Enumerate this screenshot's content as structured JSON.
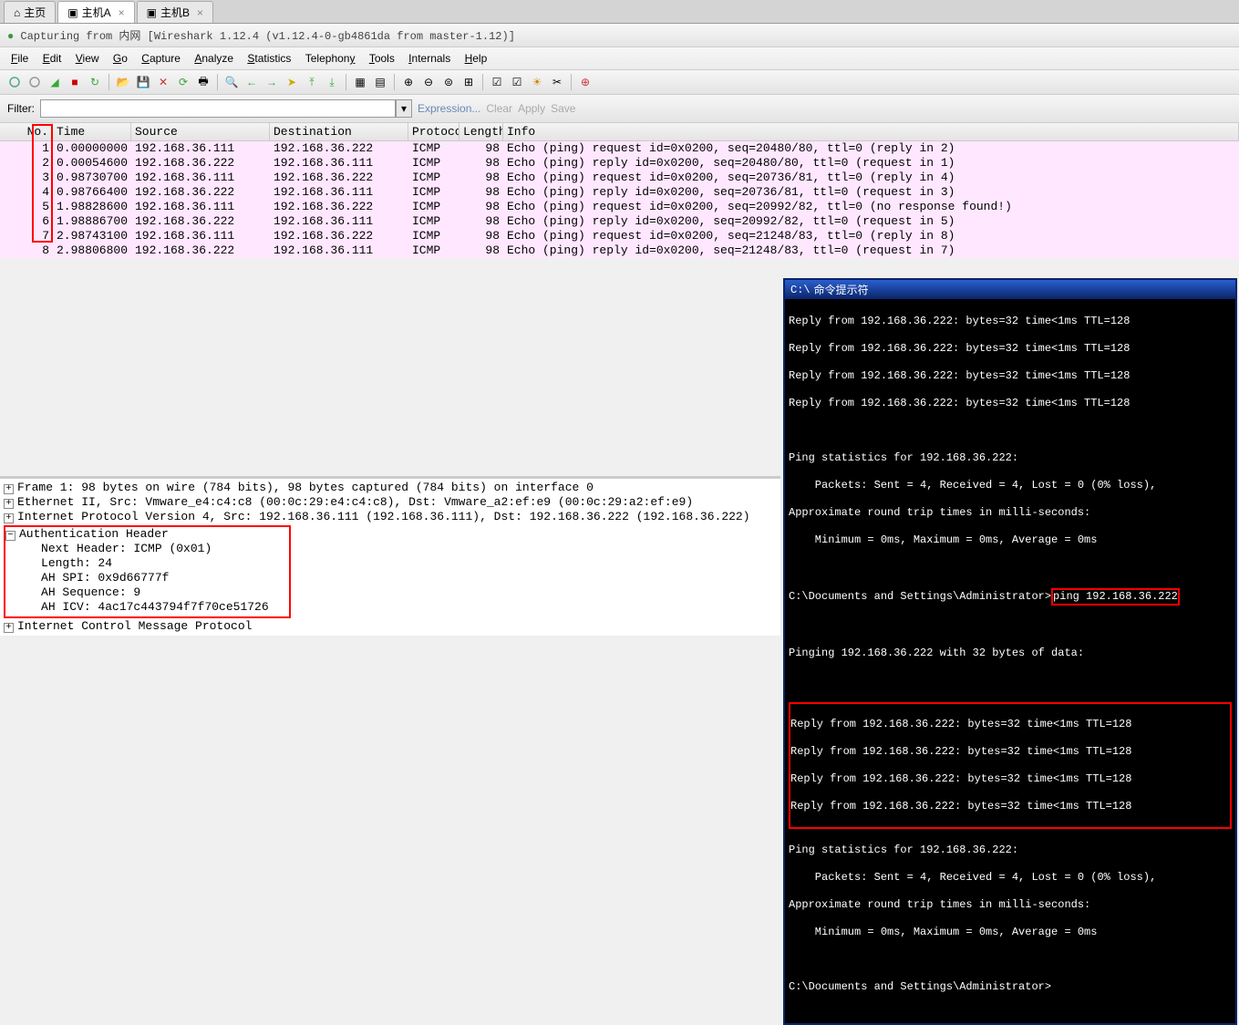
{
  "tabs": {
    "home": "主页",
    "hostA": "主机A",
    "hostB": "主机B"
  },
  "titlebar": "Capturing from 内网   [Wireshark 1.12.4  (v1.12.4-0-gb4861da from master-1.12)]",
  "menu": {
    "file": "File",
    "edit": "Edit",
    "view": "View",
    "go": "Go",
    "capture": "Capture",
    "analyze": "Analyze",
    "statistics": "Statistics",
    "telephony": "Telephony",
    "tools": "Tools",
    "internals": "Internals",
    "help": "Help"
  },
  "filter": {
    "label": "Filter:",
    "value": "",
    "expression": "Expression...",
    "clear": "Clear",
    "apply": "Apply",
    "save": "Save"
  },
  "columns": {
    "no": "No.",
    "time": "Time",
    "source": "Source",
    "destination": "Destination",
    "protocol": "Protocol",
    "length": "Length",
    "info": "Info"
  },
  "packets": [
    {
      "no": "1",
      "time": "0.00000000",
      "src": "192.168.36.111",
      "dst": "192.168.36.222",
      "proto": "ICMP",
      "len": "98",
      "info": "Echo (ping) request  id=0x0200, seq=20480/80, ttl=0 (reply in 2)"
    },
    {
      "no": "2",
      "time": "0.00054600",
      "src": "192.168.36.222",
      "dst": "192.168.36.111",
      "proto": "ICMP",
      "len": "98",
      "info": "Echo (ping) reply    id=0x0200, seq=20480/80, ttl=0 (request in 1)"
    },
    {
      "no": "3",
      "time": "0.98730700",
      "src": "192.168.36.111",
      "dst": "192.168.36.222",
      "proto": "ICMP",
      "len": "98",
      "info": "Echo (ping) request  id=0x0200, seq=20736/81, ttl=0 (reply in 4)"
    },
    {
      "no": "4",
      "time": "0.98766400",
      "src": "192.168.36.222",
      "dst": "192.168.36.111",
      "proto": "ICMP",
      "len": "98",
      "info": "Echo (ping) reply    id=0x0200, seq=20736/81, ttl=0 (request in 3)"
    },
    {
      "no": "5",
      "time": "1.98828600",
      "src": "192.168.36.111",
      "dst": "192.168.36.222",
      "proto": "ICMP",
      "len": "98",
      "info": "Echo (ping) request  id=0x0200, seq=20992/82, ttl=0 (no response found!)"
    },
    {
      "no": "6",
      "time": "1.98886700",
      "src": "192.168.36.222",
      "dst": "192.168.36.111",
      "proto": "ICMP",
      "len": "98",
      "info": "Echo (ping) reply    id=0x0200, seq=20992/82, ttl=0 (request in 5)"
    },
    {
      "no": "7",
      "time": "2.98743100",
      "src": "192.168.36.111",
      "dst": "192.168.36.222",
      "proto": "ICMP",
      "len": "98",
      "info": "Echo (ping) request  id=0x0200, seq=21248/83, ttl=0 (reply in 8)"
    },
    {
      "no": "8",
      "time": "2.98806800",
      "src": "192.168.36.222",
      "dst": "192.168.36.111",
      "proto": "ICMP",
      "len": "98",
      "info": "Echo (ping) reply    id=0x0200, seq=21248/83, ttl=0 (request in 7)"
    }
  ],
  "details": {
    "frame": "Frame 1: 98 bytes on wire (784 bits), 98 bytes captured (784 bits) on interface 0",
    "eth": "Ethernet II, Src: Vmware_e4:c4:c8 (00:0c:29:e4:c4:c8), Dst: Vmware_a2:ef:e9 (00:0c:29:a2:ef:e9)",
    "ip": "Internet Protocol Version 4, Src: 192.168.36.111 (192.168.36.111), Dst: 192.168.36.222 (192.168.36.222)",
    "ah_title": "Authentication Header",
    "ah_next": "Next Header: ICMP (0x01)",
    "ah_len": "Length: 24",
    "ah_spi": "AH SPI: 0x9d66777f",
    "ah_seq": "AH Sequence: 9",
    "ah_icv": "AH ICV: 4ac17c443794f7f70ce51726",
    "icmp": "Internet Control Message Protocol"
  },
  "cmd": {
    "title": "命令提示符",
    "reply": "Reply from 192.168.36.222: bytes=32 time<1ms TTL=128",
    "stats_hdr": "Ping statistics for 192.168.36.222:",
    "stats_pkts": "    Packets: Sent = 4, Received = 4, Lost = 0 (0% loss),",
    "approx": "Approximate round trip times in milli-seconds:",
    "minmax": "    Minimum = 0ms, Maximum = 0ms, Average = 0ms",
    "prompt": "C:\\Documents and Settings\\Administrator>",
    "pingcmd": "ping 192.168.36.222",
    "pinging": "Pinging 192.168.36.222 with 32 bytes of data:"
  }
}
